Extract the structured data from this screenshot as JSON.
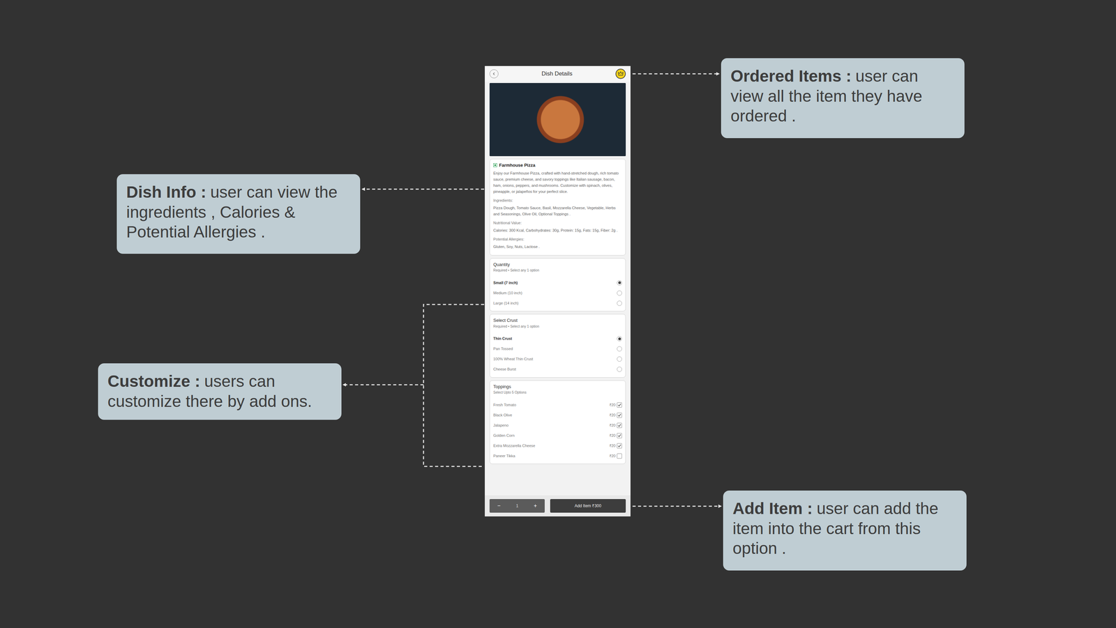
{
  "callouts": [
    {
      "title": "Ordered Items :",
      "text": "user can view all the item they have ordered ."
    },
    {
      "title": "Dish Info :",
      "text": "user can view the ingredients , Calories & Potential Allergies ."
    },
    {
      "title": "Customize :",
      "text": "users can customize there by add ons."
    },
    {
      "title": "Add Item :",
      "text": "user can add the item into the cart from this option ."
    }
  ],
  "screen": {
    "title": "Dish Details",
    "dish": {
      "name": "Farmhouse Pizza",
      "description": "Enjoy our Farmhouse Pizza, crafted with hand-stretched dough, rich tomato sauce, premium cheese, and savory toppings like Italian sausage, bacon, ham, onions, peppers, and mushrooms. Customize with spinach, olives, pineapple, or jalapeños for your perfect slice.",
      "info": [
        {
          "label": "Ingredients:",
          "value": "Pizza Dough, Tomato Sauce, Basil, Mozzarella Cheese, Vegetable, Herbs and Seasonings, Olive Oil, Optional Toppings ."
        },
        {
          "label": "Nutritional Value:",
          "value": "Calories: 300 Kcal, Carbohydrates: 30g, Protein: 15g, Fats: 15g, Fiber: 2g ."
        },
        {
          "label": "Potential Allergies:",
          "value": "Gluten, Soy, Nuts, Lactose ."
        }
      ]
    },
    "sections": [
      {
        "title": "Quantity",
        "subtitle": "Required • Select any 1 option",
        "kind": "radio",
        "options": [
          {
            "label": "Small (7 inch)",
            "selected": true
          },
          {
            "label": "Medium (10 inch)",
            "selected": false
          },
          {
            "label": "Large (14 inch)",
            "selected": false
          }
        ]
      },
      {
        "title": "Select Crust",
        "subtitle": "Required • Select any 1 option",
        "kind": "radio",
        "options": [
          {
            "label": "Thin Crust",
            "selected": true
          },
          {
            "label": "Pan Tossed",
            "selected": false
          },
          {
            "label": "100% Wheat Thin Crust",
            "selected": false
          },
          {
            "label": "Cheese Burst",
            "selected": false
          }
        ]
      },
      {
        "title": "Toppings",
        "subtitle": "Select Upto 5 Options",
        "kind": "checkbox",
        "options": [
          {
            "label": "Fresh Tomato",
            "price": "₹20",
            "checked": true
          },
          {
            "label": "Black Olive",
            "price": "₹20",
            "checked": true
          },
          {
            "label": "Jalapeno",
            "price": "₹20",
            "checked": true
          },
          {
            "label": "Golden Corn",
            "price": "₹20",
            "checked": true
          },
          {
            "label": "Extra Mozzarella Cheese",
            "price": "₹20",
            "checked": true
          },
          {
            "label": "Paneer Tikka",
            "price": "₹20",
            "checked": false
          }
        ]
      }
    ],
    "footer": {
      "minus": "−",
      "quantity": "1",
      "plus": "+",
      "button": "Add Item ₹300"
    }
  }
}
